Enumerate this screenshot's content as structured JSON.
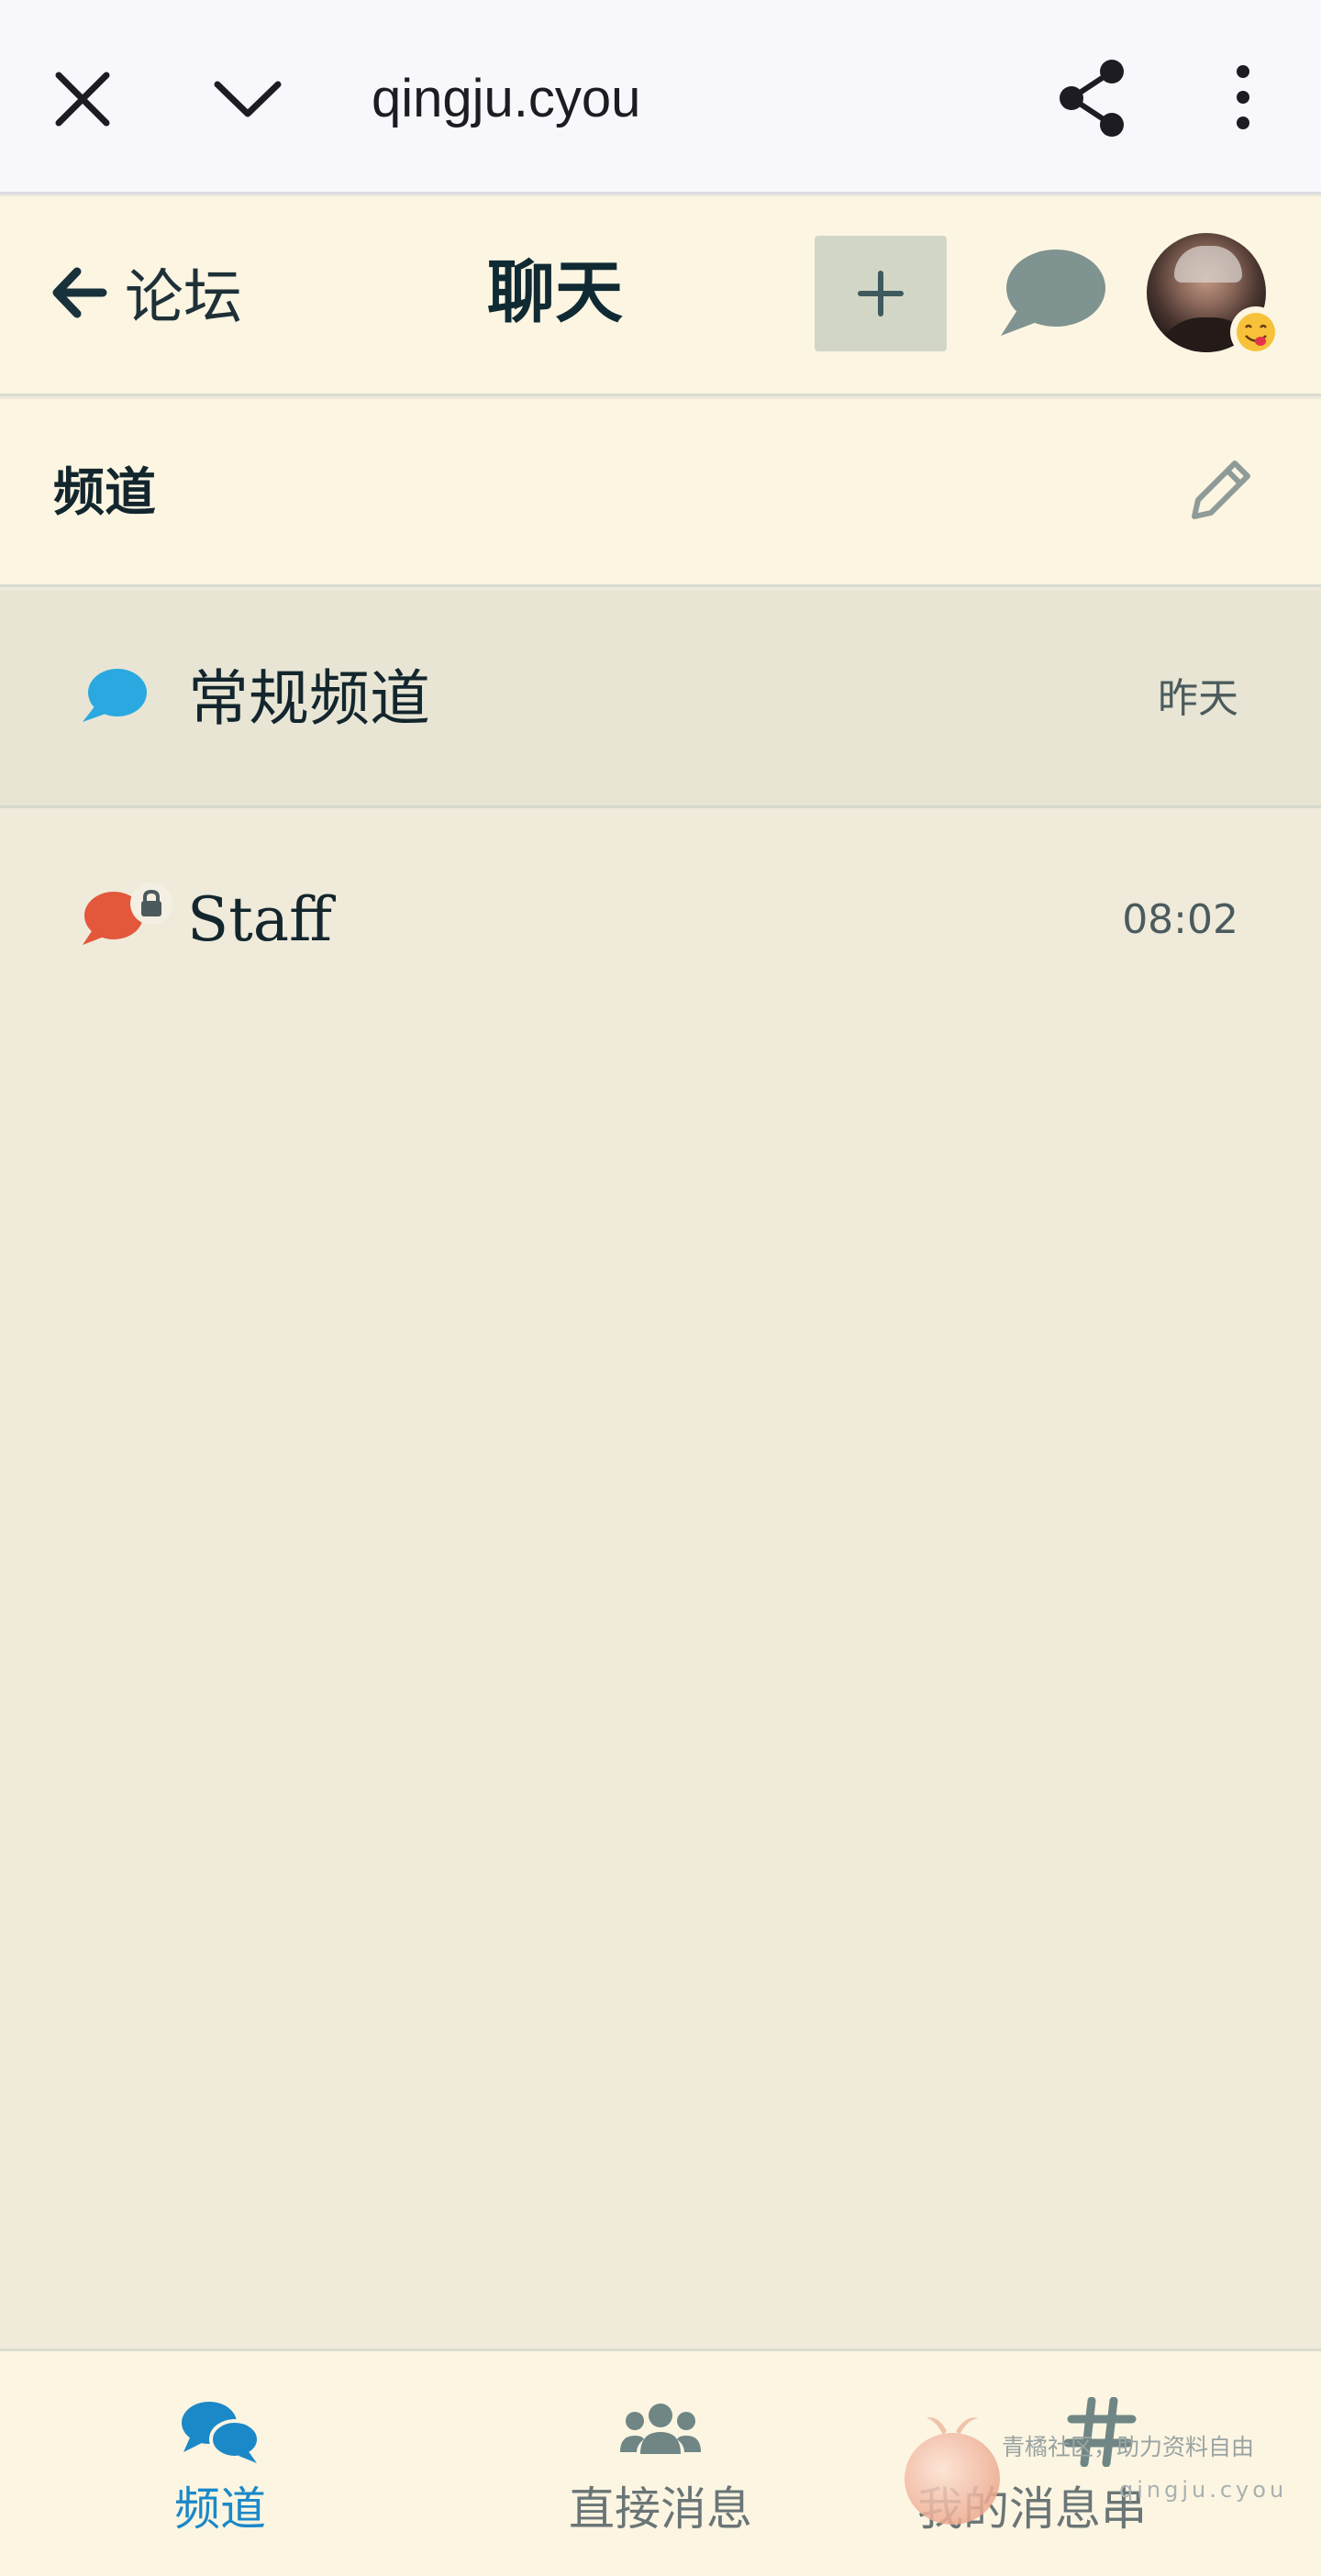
{
  "browser": {
    "url": "qingju.cyou",
    "icons": [
      "close-icon",
      "chevron-down-icon",
      "share-icon",
      "more-vertical-icon"
    ]
  },
  "header": {
    "back_label": "论坛",
    "title": "聊天",
    "new_button_icon": "plus-icon",
    "chat_button_icon": "chat-bubble-icon",
    "status_emoji_icon": "yum-face-emoji-icon"
  },
  "section": {
    "title": "频道",
    "edit_icon": "pencil-icon"
  },
  "channels": [
    {
      "name": "常规频道",
      "time": "昨天",
      "icon": "chat-bubble-icon",
      "color": "#2aa8e0",
      "private": false
    },
    {
      "name": "Staff",
      "time": "08:02",
      "icon": "chat-bubble-icon",
      "color": "#e3573a",
      "private": true
    }
  ],
  "bottom_nav": [
    {
      "label": "频道",
      "icon": "chat-bubbles-icon",
      "active": true
    },
    {
      "label": "直接消息",
      "icon": "users-icon",
      "active": false
    },
    {
      "label": "我的消息串",
      "icon": "hashtag-icon",
      "active": false
    }
  ],
  "watermark": {
    "line1": "青橘社区，助力资料自由",
    "line2": "qingju.cyou"
  },
  "colors": {
    "active_tab": "#1b88c8",
    "background": "#efeada",
    "header_bg": "#fbf5e2"
  }
}
